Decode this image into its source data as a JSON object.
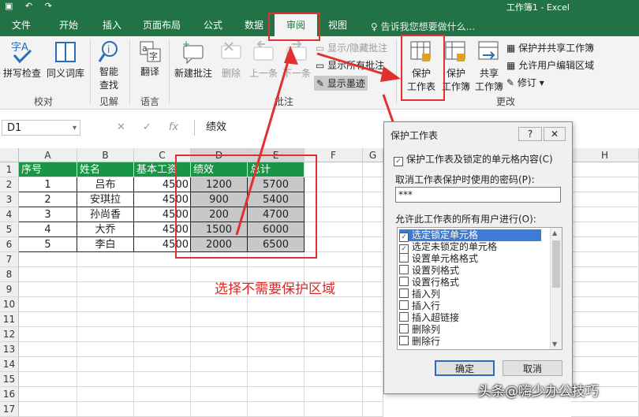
{
  "window": {
    "title": "工作簿1 - Excel",
    "qat_icons": [
      "save-icon",
      "undo-icon",
      "redo-icon"
    ]
  },
  "tabs": [
    "文件",
    "开始",
    "插入",
    "页面布局",
    "公式",
    "数据",
    "审阅",
    "视图"
  ],
  "active_tab": "审阅",
  "tell_me": "告诉我您想要做什么...",
  "ribbon": {
    "proofing": {
      "spell": "拼写检查",
      "thesaurus": "同义词库",
      "label": "校对"
    },
    "insights": {
      "smart_lookup_1": "智能",
      "smart_lookup_2": "查找",
      "label": "见解"
    },
    "language": {
      "translate": "翻译",
      "label": "语言"
    },
    "comments": {
      "new": "新建批注",
      "delete": "删除",
      "prev": "上一条",
      "next": "下一条",
      "show_hide": "显示/隐藏批注",
      "show_all": "显示所有批注",
      "show_ink": "显示墨迹",
      "label": "批注"
    },
    "changes": {
      "protect_sheet_1": "保护",
      "protect_sheet_2": "工作表",
      "protect_book_1": "保护",
      "protect_book_2": "工作簿",
      "share_book_1": "共享",
      "share_book_2": "工作簿",
      "protect_share": "保护并共享工作簿",
      "allow_edit": "允许用户编辑区域",
      "track": "修订",
      "label": "更改"
    }
  },
  "formula_bar": {
    "name_box": "D1",
    "fx": "fx",
    "content": "绩效"
  },
  "columns": [
    "A",
    "B",
    "C",
    "D",
    "E",
    "F",
    "G",
    "H"
  ],
  "rows": [
    "1",
    "2",
    "3",
    "4",
    "5",
    "6",
    "7",
    "8",
    "9",
    "10",
    "11",
    "12",
    "13",
    "14",
    "15",
    "16",
    "17"
  ],
  "sheet": {
    "header": [
      "序号",
      "姓名",
      "基本工资",
      "绩效",
      "总计"
    ],
    "data": [
      [
        "1",
        "吕布",
        "4500",
        "1200",
        "5700"
      ],
      [
        "2",
        "安琪拉",
        "4500",
        "900",
        "5400"
      ],
      [
        "3",
        "孙尚香",
        "4500",
        "200",
        "4700"
      ],
      [
        "4",
        "大乔",
        "4500",
        "1500",
        "6000"
      ],
      [
        "5",
        "李白",
        "4500",
        "2000",
        "6500"
      ]
    ]
  },
  "dialog": {
    "title": "保护工作表",
    "help": "?",
    "close": "✕",
    "protect_check": "保护工作表及锁定的单元格内容(C)",
    "password_label": "取消工作表保护时使用的密码(P):",
    "password_value": "***",
    "allow_label": "允许此工作表的所有用户进行(O):",
    "options": [
      {
        "label": "选定锁定单元格",
        "checked": true
      },
      {
        "label": "选定未锁定的单元格",
        "checked": true
      },
      {
        "label": "设置单元格格式",
        "checked": false
      },
      {
        "label": "设置列格式",
        "checked": false
      },
      {
        "label": "设置行格式",
        "checked": false
      },
      {
        "label": "插入列",
        "checked": false
      },
      {
        "label": "插入行",
        "checked": false
      },
      {
        "label": "插入超链接",
        "checked": false
      },
      {
        "label": "删除列",
        "checked": false
      },
      {
        "label": "删除行",
        "checked": false
      }
    ],
    "ok": "确定",
    "cancel": "取消"
  },
  "annotation": "选择不需要保护区域",
  "watermark": "头条@嗨少办公技巧",
  "colors": {
    "excel_green": "#217346",
    "header_fill": "#1a9545",
    "annotation_red": "#e03030"
  }
}
